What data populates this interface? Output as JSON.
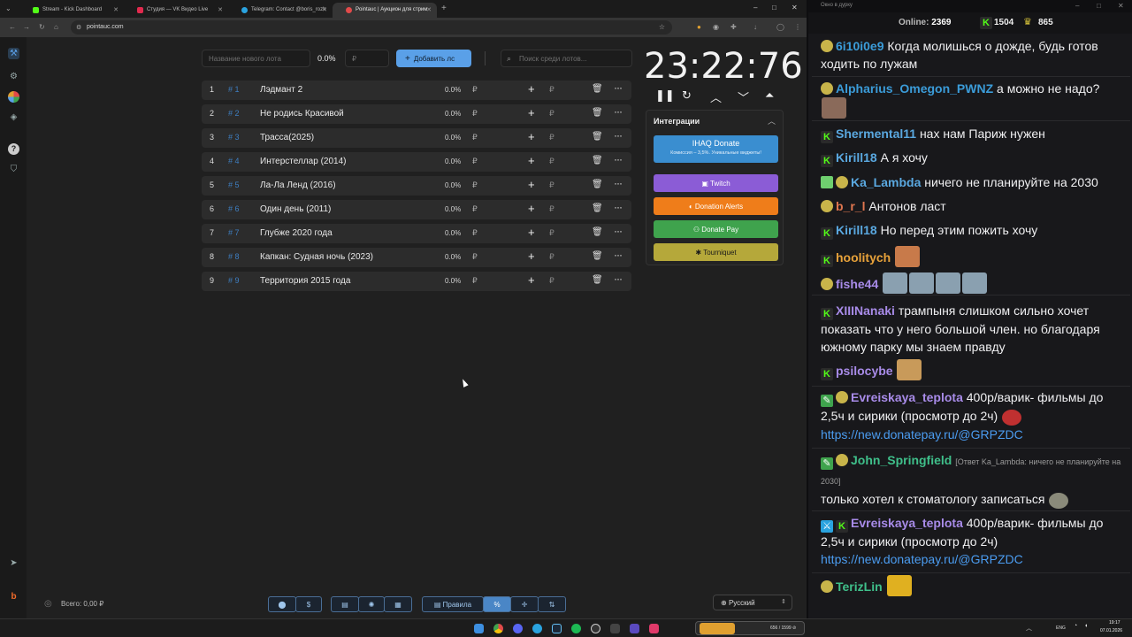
{
  "browser": {
    "tabs": [
      {
        "label": "Stream - Kick Dashboard",
        "color": "#53fc18"
      },
      {
        "label": "Студия — VK Видео Live",
        "color": "#e22a4e"
      },
      {
        "label": "Telegram: Contact @boris_rozh",
        "color": "#2aa3df"
      },
      {
        "label": "Pointauc | Аукцион для стрим",
        "color": "#e24a4a"
      }
    ],
    "add_tab": "+",
    "url": "pointauc.com",
    "window_controls": {
      "minimize": "–",
      "maximize": "□",
      "close": "✕"
    }
  },
  "auction": {
    "new_lot_placeholder": "Название нового лота",
    "percent_default": "0.0%",
    "amount_placeholder": "₽",
    "add_button": "Добавить лс",
    "search_placeholder": "Поиск среди лотов...",
    "lots": [
      {
        "n": "1",
        "id": "# 1",
        "name": "Лэдмант 2",
        "pct": "0.0%",
        "cur": "₽"
      },
      {
        "n": "2",
        "id": "# 2",
        "name": "Не родись Красивой",
        "pct": "0.0%",
        "cur": "₽"
      },
      {
        "n": "3",
        "id": "# 3",
        "name": "Трасса(2025)",
        "pct": "0.0%",
        "cur": "₽"
      },
      {
        "n": "4",
        "id": "# 4",
        "name": "Интерстеллар (2014)",
        "pct": "0.0%",
        "cur": "₽"
      },
      {
        "n": "5",
        "id": "# 5",
        "name": "Ла-Ла Ленд (2016)",
        "pct": "0.0%",
        "cur": "₽"
      },
      {
        "n": "6",
        "id": "# 6",
        "name": "Один день (2011)",
        "pct": "0.0%",
        "cur": "₽"
      },
      {
        "n": "7",
        "id": "# 7",
        "name": "Глубже 2020 года",
        "pct": "0.0%",
        "cur": "₽"
      },
      {
        "n": "8",
        "id": "# 8",
        "name": "Капкан: Судная ночь (2023)",
        "pct": "0.0%",
        "cur": "₽"
      },
      {
        "n": "9",
        "id": "# 9",
        "name": "Территория 2015 года",
        "pct": "0.0%",
        "cur": "₽"
      }
    ],
    "timer": "23:22:76",
    "integrations": {
      "title": "Интеграции",
      "ihaq_title": "IHAQ Donate",
      "ihaq_sub": "Комиссия – 3,5%. Уникальные виджеты!",
      "buttons": [
        {
          "label": "Twitch",
          "bg": "#8b5cd6",
          "fg": "#ffffff"
        },
        {
          "label": "Donation Alerts",
          "bg": "#ef7d1a",
          "fg": "#ffffff"
        },
        {
          "label": "Donate Pay",
          "bg": "#3fa34d",
          "fg": "#ffffff"
        },
        {
          "label": "Tourniquet",
          "bg": "#b5a83a",
          "fg": "#1a1a1a"
        }
      ]
    },
    "total": "Всего: 0,00 ₽",
    "rules_button": "Правила",
    "percent_button": "%",
    "language": "Русский"
  },
  "chat": {
    "window_title": "Окно в дурку",
    "online_label": "Online:",
    "online_count": "2369",
    "count_kick": "1504",
    "count_other": "865",
    "messages": [
      {
        "user": "6i10i0e9",
        "color": "#3b9cd9",
        "text": "Когда молишься о дожде, будь готов ходить по лужам"
      },
      {
        "user": "Alpharius_Omegon_PWNZ",
        "color": "#3b9cd9",
        "text": "а можно не надо?"
      },
      {
        "user": "Shermental11",
        "color": "#5aa8e0",
        "text": "нах нам Париж нужен"
      },
      {
        "user": "Kirill18",
        "color": "#5aa8e0",
        "text": "А я хочу"
      },
      {
        "user": "Ka_Lambda",
        "color": "#5aa8e0",
        "text": "ничего не планируйте на 2030"
      },
      {
        "user": "b_r_l",
        "color": "#e0764f",
        "text": "Антонов ласт"
      },
      {
        "user": "Kirill18",
        "color": "#5aa8e0",
        "text": "Но перед этим пожить хочу"
      },
      {
        "user": "hoolitych",
        "color": "#e8a23a",
        "text": ""
      },
      {
        "user": "fishe44",
        "color": "#a88be8",
        "text": ""
      },
      {
        "user": "XIIINanaki",
        "color": "#a88be8",
        "text": "трампыня слишком сильно хочет показать что у него большой член. но благодаря южному парку мы знаем правду"
      },
      {
        "user": "psilocybe",
        "color": "#a88be8",
        "text": ""
      },
      {
        "user": "Evreiskaya_teplota",
        "color": "#a88be8",
        "text": "400р/варик- фильмы до 2,5ч и сирики (просмотр до 2ч)",
        "link": "https://new.donatepay.ru/@GRPZDC"
      },
      {
        "user": "John_Springfield",
        "color": "#3fbf8a",
        "reply": "[Ответ Ka_Lambda: ничего не планируйте на 2030]",
        "text": "только хотел к стоматологу записаться"
      },
      {
        "user": "Evreiskaya_teplota",
        "color": "#a88be8",
        "text": "400р/варик- фильмы до 2,5ч и сирики (просмотр до 2ч)",
        "link": "https://new.donatepay.ru/@GRPZDC"
      },
      {
        "user": "TerizLin",
        "color": "#3fbf8a",
        "text": ""
      }
    ]
  },
  "taskbar": {
    "lang": "ENG",
    "time": "19:17",
    "date": "07.01.2026",
    "widget": "656 / 1599 ⊘"
  }
}
